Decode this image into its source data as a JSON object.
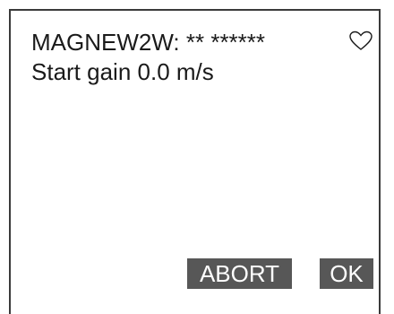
{
  "screen": {
    "line1": "MAGNEW2W: ** ******",
    "line2": "Start gain 0.0 m/s",
    "status_icon": "heart-icon"
  },
  "buttons": {
    "abort_label": "ABORT",
    "ok_label": "OK"
  },
  "colors": {
    "button_bg": "#575757",
    "button_text": "#ffffff",
    "text": "#1a1a1a",
    "border": "#3a3a3a"
  }
}
